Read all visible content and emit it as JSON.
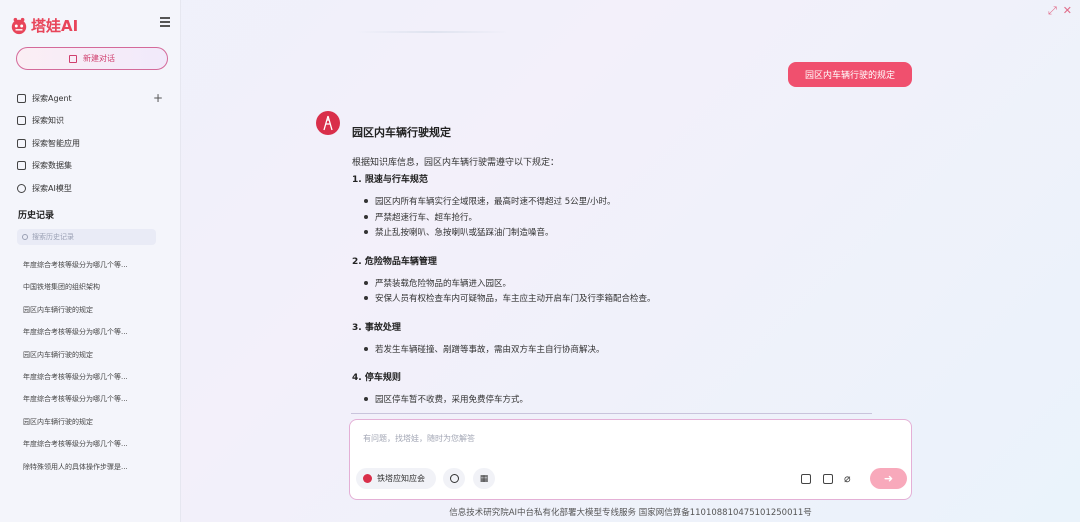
{
  "app": {
    "logo_text": "塔娃AI",
    "brand_color": "#e8455a"
  },
  "sidebar": {
    "new_chat_label": "新建对话",
    "items": [
      {
        "label": "探索Agent",
        "icon": "home-icon"
      },
      {
        "label": "探索知识",
        "icon": "book-icon"
      },
      {
        "label": "探索智能应用",
        "icon": "app-icon"
      },
      {
        "label": "探索数据集",
        "icon": "dataset-icon"
      },
      {
        "label": "探索AI模型",
        "icon": "model-icon"
      }
    ],
    "history_title": "历史记录",
    "history_search_placeholder": "搜索历史记录",
    "history": [
      "年度综合考核等级分为哪几个等...",
      "中国铁塔集团的组织架构",
      "园区内车辆行驶的规定",
      "年度综合考核等级分为哪几个等...",
      "园区内车辆行驶的规定",
      "年度综合考核等级分为哪几个等...",
      "年度综合考核等级分为哪几个等...",
      "园区内车辆行驶的规定",
      "年度综合考核等级分为哪几个等...",
      "除特殊领用人的具体操作步骤是..."
    ]
  },
  "chat": {
    "user_message": "园区内车辆行驶的规定",
    "answer_title": "园区内车辆行驶规定",
    "answer_intro": "根据知识库信息，园区内车辆行驶需遵守以下规定：",
    "sections": [
      {
        "title": "1. 限速与行车规范",
        "bullets": [
          "园区内所有车辆实行全域限速，最高时速不得超过 5公里/小时。",
          "严禁超速行车、超车抢行。",
          "禁止乱按喇叭、急按喇叭或猛踩油门制造噪音。"
        ]
      },
      {
        "title": "2. 危险物品车辆管理",
        "bullets": [
          "严禁装载危险物品的车辆进入园区。",
          "安保人员有权检查车内可疑物品，车主应主动开启车门及行李箱配合检查。"
        ]
      },
      {
        "title": "3. 事故处理",
        "bullets": [
          "若发生车辆碰撞、剐蹭等事故，需由双方车主自行协商解决。"
        ]
      },
      {
        "title": "4. 停车规则",
        "bullets": [
          "园区停车暂不收费，采用免费停车方式。"
        ]
      }
    ]
  },
  "input": {
    "placeholder": "有问题，找塔娃，随时为您解答",
    "knowledge_chip": "铁塔应知应会",
    "send_icon": "arrow-right-icon"
  },
  "footer": "信息技术研究院AI中台私有化部署大模型专线服务 国家网信算备110108810475101250011号",
  "colors": {
    "user_bubble": "#f0506e",
    "send_button": "#f8a9bb"
  }
}
